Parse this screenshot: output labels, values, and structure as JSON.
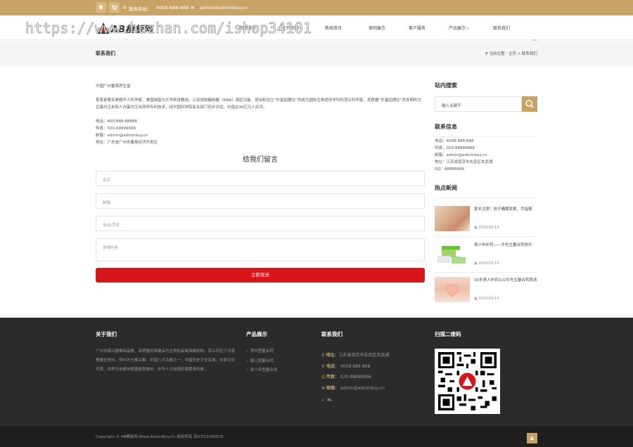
{
  "topbar": {
    "phone_label": "服务热线：",
    "phone": "4008-888-888",
    "email": "admin@adminbuy.cn"
  },
  "header": {
    "logo_text": "AB模板网",
    "nav": [
      {
        "label": "网站首页"
      },
      {
        "label": "关于我们"
      },
      {
        "label": "新闻资讯"
      },
      {
        "label": "案例展示"
      },
      {
        "label": "客户服务"
      },
      {
        "label": "产品展示",
        "has_dropdown": true
      },
      {
        "label": "联系我们"
      }
    ]
  },
  "watermark": "https://www.huzhan.com/ishop34101",
  "page": {
    "title": "联系我们",
    "breadcrumb": {
      "prefix": "当前位置：",
      "home": "主页",
      "sep": ">",
      "current": "联系我们"
    }
  },
  "main": {
    "company": "中国广州番禺养生堂",
    "intro": "某某是著名美籍华人科学家、美国细普尔大学终身教授，以发现核糖核酸（RNA）调控功能、提出和创立“外基因理论”而成为国际生物遗传学科的顶尖科学家。其根据“外基因理论”而发明的大豆蛋白玉米和人白蛋白玉米两项专利技术，经中国科学院有关部门初步评估，价值达30亿元人民币。",
    "contacts": [
      "电话：400-888-88888",
      "传真：020-99999999",
      "邮箱：admin@adminbuy.cn",
      "地址：广东省广州市番禺经济开发区"
    ]
  },
  "form": {
    "title": "给我们留言",
    "name_placeholder": "名字",
    "email_placeholder": "邮箱",
    "phone_placeholder": "电话/手机",
    "content_placeholder": "详细内容",
    "submit": "立即发送"
  },
  "sidebar": {
    "search_title": "站内搜索",
    "search_placeholder": "输入关键字",
    "contact_title": "联系信息",
    "contact_lines": [
      "电话：4008-888-888",
      "传真：020-88888888",
      "邮箱：admin@adminbuy.cn",
      "地址：江苏省南京市玄武区玄武湖",
      "QQ：88888888"
    ],
    "news_title": "热点新闻",
    "news": [
      {
        "title": "家长注意！孩子确属发索、手指报",
        "date": "2019-03-14"
      },
      {
        "title": "青少年补钙——牛先生鳌合钙快乐",
        "date": "2019-03-14"
      },
      {
        "title": "30岁男人补钙以以牛先生鳌合钙首选",
        "date": "2019-03-14"
      }
    ]
  },
  "footer": {
    "about_title": "关于我们",
    "about_text": "广州市恩以建佛商品质、高质量的保健品为主线的高端保健机构。其公司位于河南菁善全郑州。郑州为七都古都、中国八大古都之一、中国历史文化名城、中原文化代表、世界历史都市联盟成员城市、中华人文始祖轩辕黄帝的故...",
    "products_title": "产品展示",
    "products": [
      "孕妇型鳌合钙",
      "婴儿型鳌合钙",
      "青少年型鳌合钙"
    ],
    "contact_title": "联系我们",
    "contact": [
      {
        "label": "地址：",
        "value": "江苏省南京市玄武区玄武湖"
      },
      {
        "label": "电话：",
        "value": "4008-888-888"
      },
      {
        "label": "传真：",
        "value": "020-88888888"
      },
      {
        "label": "邮箱：",
        "value": "admin@adminbuy.cn"
      }
    ],
    "qr_title": "扫描二维码",
    "copyright": "Copyright © AB模板网 Www.AdminBuy.Cn 版权所有  苏ICP12345678"
  },
  "colors": {
    "brand_gold": "#c8a365",
    "submit_red": "#d8151b",
    "footer_bg": "#2b2b2b"
  }
}
